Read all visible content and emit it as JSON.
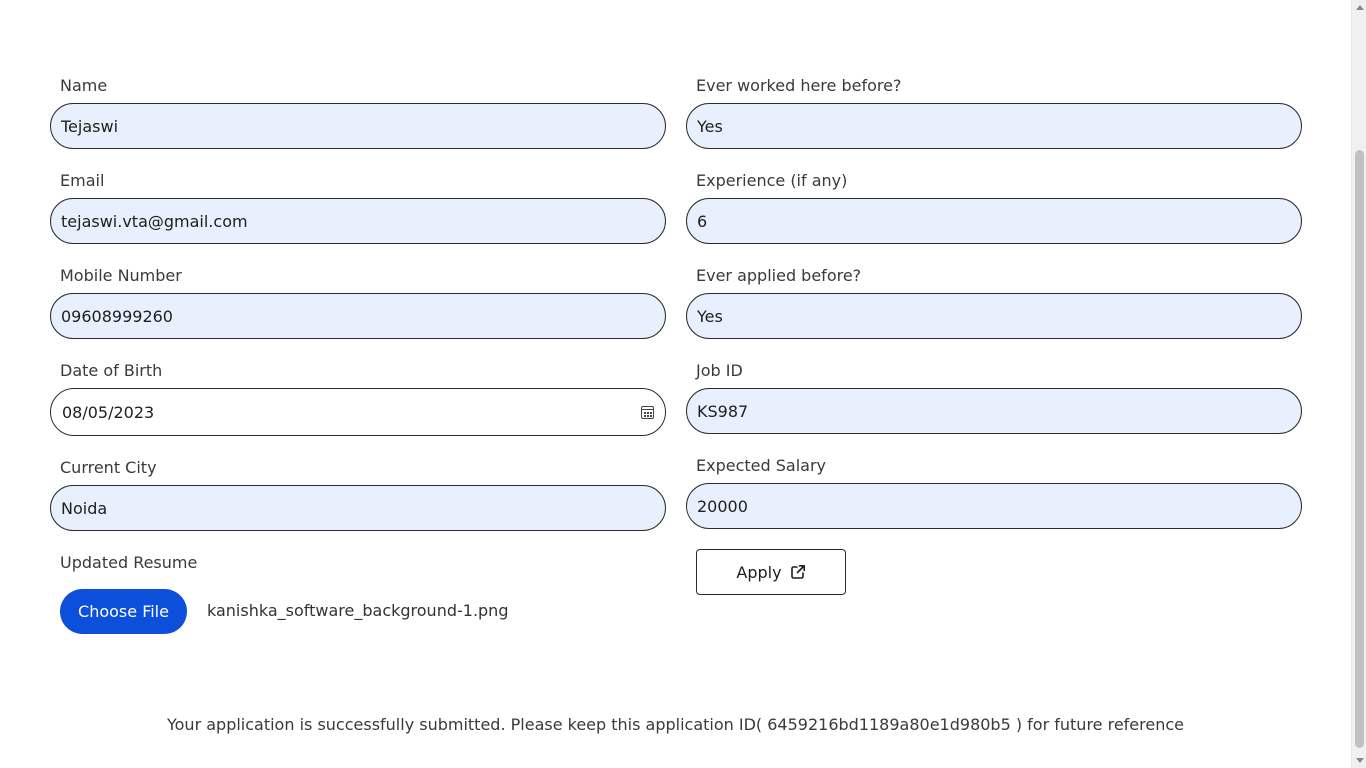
{
  "form": {
    "name": {
      "label": "Name",
      "value": "Tejaswi"
    },
    "email": {
      "label": "Email",
      "value": "tejaswi.vta@gmail.com"
    },
    "mobile": {
      "label": "Mobile Number",
      "value": "09608999260"
    },
    "dob": {
      "label": "Date of Birth",
      "value": "08/05/2023"
    },
    "city": {
      "label": "Current City",
      "value": "Noida"
    },
    "resume": {
      "label": "Updated Resume",
      "button_label": "Choose File",
      "file_name": "kanishka_software_background-1.png"
    },
    "worked_before": {
      "label": "Ever worked here before?",
      "value": "Yes"
    },
    "experience": {
      "label": "Experience (if any)",
      "value": "6"
    },
    "applied_before": {
      "label": "Ever applied before?",
      "value": "Yes"
    },
    "job_id": {
      "label": "Job ID",
      "value": "KS987"
    },
    "salary": {
      "label": "Expected Salary",
      "value": "20000"
    },
    "apply": {
      "label": "Apply",
      "icon": "external-link-icon"
    }
  },
  "status": {
    "message": "Your application is successfully submitted. Please keep this application ID( 6459216bd1189a80e1d980b5 ) for future reference"
  },
  "colors": {
    "input_bg": "#e8f0fe",
    "primary_button": "#0b4fdb"
  }
}
